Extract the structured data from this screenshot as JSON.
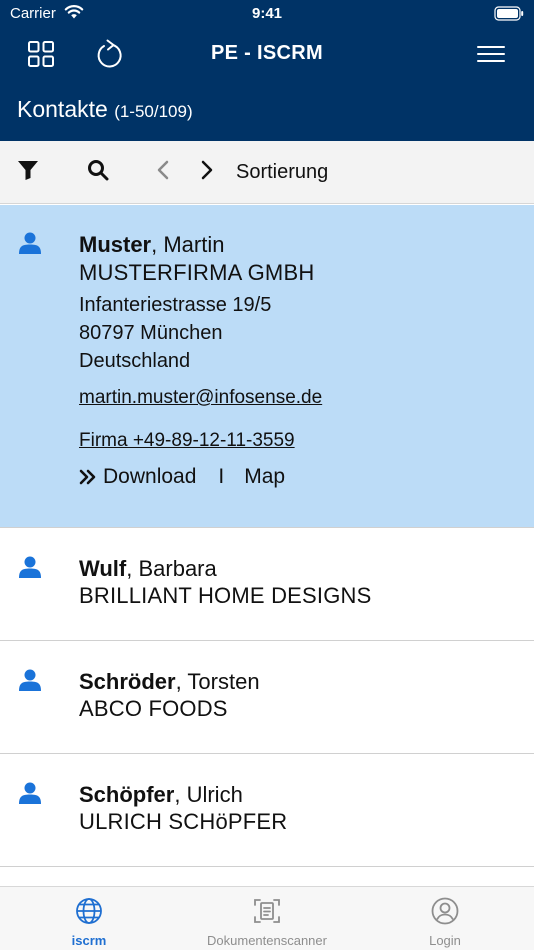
{
  "status_bar": {
    "carrier": "Carrier",
    "time": "9:41"
  },
  "nav": {
    "title": "PE - ISCRM"
  },
  "header": {
    "title": "Kontakte",
    "count": "(1-50/109)"
  },
  "toolbar": {
    "sort_label": "Sortierung"
  },
  "contacts": [
    {
      "last_name": "Muster",
      "first_name": ", Martin",
      "company": "MUSTERFIRMA GMBH",
      "street": "Infanteriestrasse 19/5",
      "city": "80797 München",
      "country": "Deutschland",
      "email": "martin.muster@infosense.de",
      "phone": "Firma +49-89-12-11-3559",
      "download_label": "Download",
      "separator": "I",
      "map_label": "Map"
    },
    {
      "last_name": "Wulf",
      "first_name": ", Barbara",
      "company": "BRILLIANT HOME DESIGNS"
    },
    {
      "last_name": "Schröder",
      "first_name": ", Torsten",
      "company": "ABCO FOODS"
    },
    {
      "last_name": "Schöpfer",
      "first_name": ", Ulrich",
      "company": "ULRICH SCHöPFER"
    }
  ],
  "tabs": [
    {
      "label": "iscrm",
      "icon": "globe-icon",
      "active": true
    },
    {
      "label": "Dokumentenscanner",
      "icon": "document-scanner-icon",
      "active": false
    },
    {
      "label": "Login",
      "icon": "user-circle-icon",
      "active": false
    }
  ],
  "colors": {
    "brand": "#003366",
    "selected_row": "#bcdcf7",
    "accent": "#1f6fd1"
  }
}
